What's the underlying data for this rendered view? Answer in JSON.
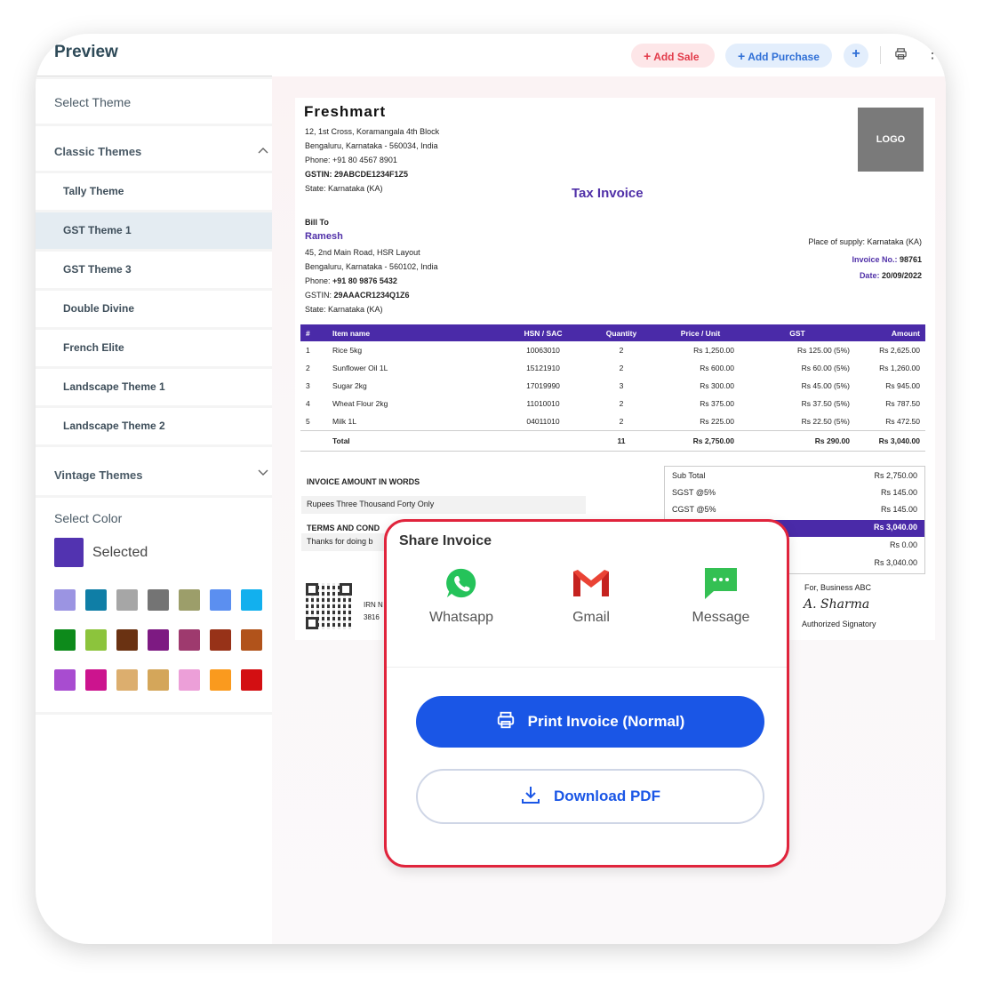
{
  "sidebar": {
    "title": "Preview",
    "select_theme": "Select Theme",
    "classic_label": "Classic Themes",
    "classic_chevron": "^",
    "themes": [
      "Tally Theme",
      "GST Theme 1",
      "GST Theme 3",
      "Double Divine",
      "French Elite",
      "Landscape Theme 1",
      "Landscape Theme 2"
    ],
    "active_theme": "GST Theme 1",
    "vintage_label": "Vintage Themes",
    "vintage_chevron": "v",
    "select_color": "Select Color",
    "selected_label": "Selected",
    "selected_color": "#5233b0",
    "swatches": [
      "#9b94e2",
      "#0f7ea6",
      "#a6a6a6",
      "#747474",
      "#9c9e6a",
      "#5b8ff0",
      "#12b0ee",
      "#0d8a1b",
      "#8cc43c",
      "#6a3212",
      "#7d1a82",
      "#9e3a6e",
      "#973218",
      "#b1531b",
      "#a84cd0",
      "#cc148e",
      "#dcae6e",
      "#d4a65a",
      "#ec9fd8",
      "#fa9a1e",
      "#d30f12"
    ]
  },
  "topbar": {
    "add_sale": "Add Sale",
    "add_purchase": "Add Purchase",
    "plus": "+",
    "kebab": "⋮"
  },
  "invoice": {
    "company": "Freshmart",
    "addr1": "12, 1st Cross, Koramangala 4th Block",
    "addr2": "Bengaluru, Karnataka - 560034, India",
    "phone": "Phone: +91 80 4567 8901",
    "gstin": "GSTIN: 29ABCDE1234F1Z5",
    "state": "State: Karnataka (KA)",
    "logo": "LOGO",
    "title": "Tax Invoice",
    "bill_to": "Bill To",
    "customer": "Ramesh",
    "c_addr1": "45, 2nd Main Road, HSR Layout",
    "c_addr2": "Bengaluru, Karnataka - 560102, India",
    "c_phone_label": "Phone: ",
    "c_phone": "+91 80 9876 5432",
    "c_gstin_label": "GSTIN: ",
    "c_gstin": "29AAACR1234Q1Z6",
    "c_state": "State: Karnataka (KA)",
    "place_of_supply": "Place of supply: Karnataka (KA)",
    "invoice_no_label": "Invoice No.: ",
    "invoice_no": "98761",
    "date_label": "Date: ",
    "date": "20/09/2022",
    "columns": [
      "#",
      "Item name",
      "HSN / SAC",
      "Quantity",
      "Price / Unit",
      "GST",
      "Amount"
    ],
    "rows": [
      [
        "1",
        "Rice 5kg",
        "10063010",
        "2",
        "Rs 1,250.00",
        "Rs 125.00 (5%)",
        "Rs 2,625.00"
      ],
      [
        "2",
        "Sunflower Oil 1L",
        "15121910",
        "2",
        "Rs 600.00",
        "Rs 60.00 (5%)",
        "Rs 1,260.00"
      ],
      [
        "3",
        "Sugar 2kg",
        "17019990",
        "3",
        "Rs 300.00",
        "Rs 45.00 (5%)",
        "Rs 945.00"
      ],
      [
        "4",
        "Wheat Flour 2kg",
        "11010010",
        "2",
        "Rs 375.00",
        "Rs 37.50 (5%)",
        "Rs 787.50"
      ],
      [
        "5",
        "Milk 1L",
        "04011010",
        "2",
        "Rs 225.00",
        "Rs 22.50 (5%)",
        "Rs 472.50"
      ]
    ],
    "total": {
      "label": "Total",
      "qty": "11",
      "price": "Rs 2,750.00",
      "gst": "Rs 290.00",
      "amount": "Rs 3,040.00"
    },
    "words_label": "INVOICE AMOUNT IN WORDS",
    "words": "Rupees Three Thousand Forty Only",
    "terms_label": "TERMS AND COND",
    "terms": "Thanks for doing b",
    "summary": [
      {
        "label": "Sub Total",
        "value": "Rs 2,750.00"
      },
      {
        "label": "SGST @5%",
        "value": "Rs 145.00"
      },
      {
        "label": "CGST @5%",
        "value": "Rs 145.00"
      },
      {
        "label": "",
        "value": "Rs 3,040.00"
      },
      {
        "label": "",
        "value": "Rs 0.00"
      },
      {
        "label": "",
        "value": "Rs 3,040.00"
      }
    ],
    "irn_label": "IRN N",
    "irn_value": "3816",
    "for_business": "For, Business ABC",
    "signature": "A. Sharma",
    "signatory": "Authorized Signatory"
  },
  "share": {
    "title": "Share Invoice",
    "options": [
      "Whatsapp",
      "Gmail",
      "Message"
    ],
    "print_label": "Print Invoice (Normal)",
    "pdf_label": "Download PDF"
  }
}
